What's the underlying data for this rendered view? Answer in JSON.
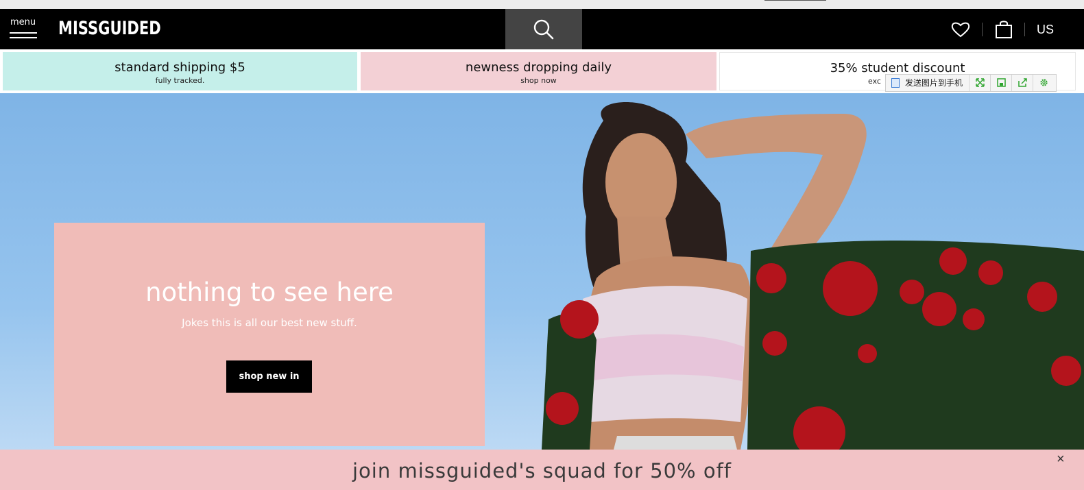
{
  "header": {
    "menu_label": "menu",
    "logo": "MISSGUIDED",
    "region": "US",
    "icons": [
      "menu-icon",
      "search-icon",
      "heart-icon",
      "bag-icon"
    ]
  },
  "promos": [
    {
      "title": "standard shipping $5",
      "subtitle": "fully tracked."
    },
    {
      "title": "newness dropping daily",
      "subtitle": "shop now"
    },
    {
      "title": "35% student discount",
      "subtitle": "exc"
    }
  ],
  "image_toolbar": {
    "send_label": "发送图片到手机",
    "icons": [
      "fullscreen-icon",
      "save-icon",
      "share-icon",
      "settings-icon"
    ]
  },
  "hero": {
    "title": "nothing to see here",
    "subtitle": "Jokes this is all our best new stuff.",
    "button": "shop new in"
  },
  "squad_banner": {
    "text": "join missguided's squad for 50% off",
    "close": "×"
  },
  "colors": {
    "header_bg": "#000000",
    "search_bg": "#444444",
    "promo_mint": "#c5efea",
    "promo_pink": "#f3d0d5",
    "hero_card": "#f0bcb8",
    "squad_bg": "#f2c3c6"
  }
}
